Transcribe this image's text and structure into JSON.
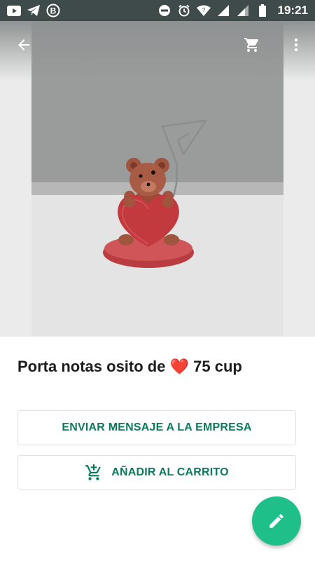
{
  "status_bar": {
    "time": "19:21",
    "left_icons": [
      "youtube-icon",
      "telegram-icon",
      "b-circle-icon"
    ],
    "right_icons": [
      "do-not-disturb-icon",
      "alarm-icon",
      "wifi-icon",
      "signal-icon",
      "signal-icon",
      "battery-icon"
    ]
  },
  "app_bar": {
    "back_icon": "arrow-left-icon",
    "cart_icon": "cart-icon",
    "menu_icon": "more-vert-icon"
  },
  "product": {
    "title_before": "Porta notas osito de",
    "emoji": "❤️",
    "title_after": "75 cup",
    "image_alt": "teddy-bear-heart-note-holder"
  },
  "actions": {
    "message_label": "ENVIAR MENSAJE A LA EMPRESA",
    "add_to_cart_label": "AÑADIR AL CARRITO",
    "add_to_cart_icon": "cart-plus-icon"
  },
  "fab": {
    "icon": "pencil-icon"
  },
  "colors": {
    "accent": "#0a7a5c",
    "fab": "#1fbf8a",
    "status_bar": "#3f4a4a"
  }
}
